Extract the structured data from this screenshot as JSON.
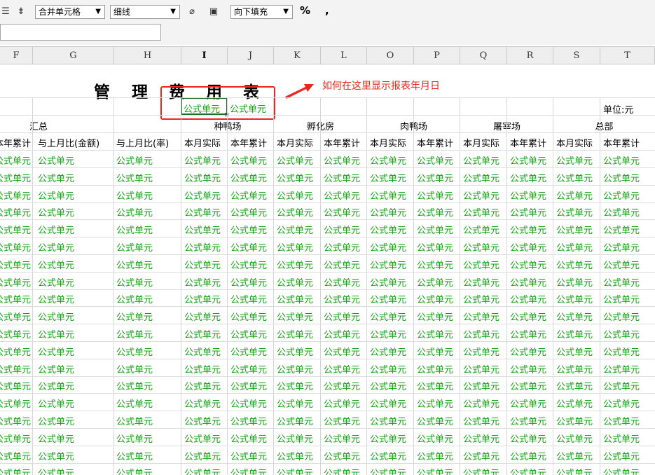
{
  "toolbar": {
    "merge_select": "合并单元格",
    "line_select": "细线",
    "fill_select": "向下填充",
    "percent_glyph": "%",
    "comma_glyph": ","
  },
  "columns": [
    "F",
    "G",
    "H",
    "I",
    "J",
    "K",
    "L",
    "O",
    "P",
    "Q",
    "R",
    "S",
    "T"
  ],
  "sheet": {
    "title_chars": [
      "管",
      "理",
      "费",
      "用",
      "表"
    ],
    "unit_label": "单位:元",
    "formula_text": "公式单元",
    "groups": [
      "汇总",
      "种鸭场",
      "孵化房",
      "肉鸭场",
      "屠宰场",
      "总部"
    ],
    "subheaders": [
      "本年累计",
      "与上月比(金额)",
      "与上月比(率)",
      "本月实际",
      "本年累计",
      "本月实际",
      "本年累计",
      "本月实际",
      "本年累计",
      "本月实际",
      "本年累计",
      "本月实际",
      "本年累计"
    ]
  },
  "annotation": {
    "text": "如何在这里显示报表年月日",
    "color": "#e8281f"
  },
  "colors": {
    "formula_green": "#12a312",
    "selection_green": "#1e6b32",
    "annotation_red": "#e8281f"
  }
}
